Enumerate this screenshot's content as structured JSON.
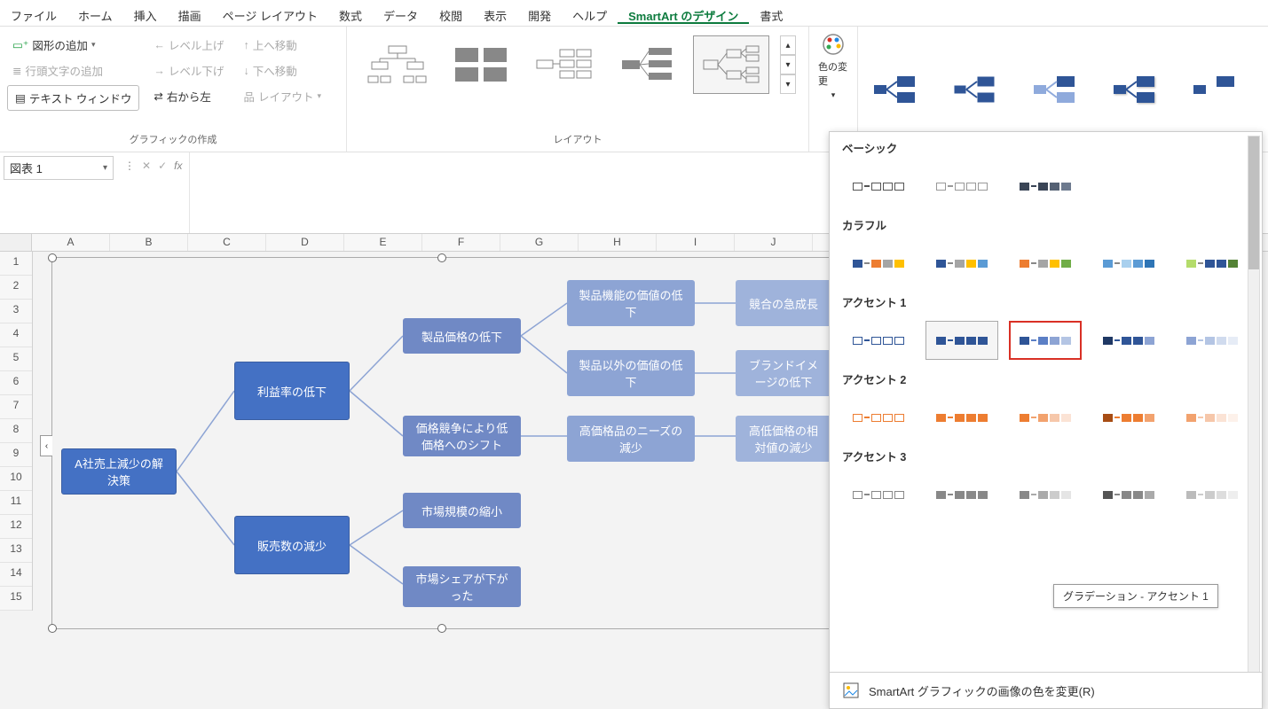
{
  "menu": {
    "items": [
      "ファイル",
      "ホーム",
      "挿入",
      "描画",
      "ページ レイアウト",
      "数式",
      "データ",
      "校閲",
      "表示",
      "開発",
      "ヘルプ",
      "SmartArt のデザイン",
      "書式"
    ],
    "active_index": 11
  },
  "ribbon": {
    "graphics_group": {
      "label": "グラフィックの作成",
      "add_shape": "図形の追加",
      "add_bullet": "行頭文字の追加",
      "text_pane": "テキスト ウィンドウ",
      "promote": "レベル上げ",
      "demote": "レベル下げ",
      "rtl": "右から左",
      "move_up": "上へ移動",
      "move_down": "下へ移動",
      "layout_btn": "レイアウト"
    },
    "layout_group": {
      "label": "レイアウト"
    },
    "color_change": {
      "label": "色の変更"
    }
  },
  "name_box": "図表 1",
  "columns": [
    "A",
    "B",
    "C",
    "D",
    "E",
    "F",
    "G",
    "H",
    "I",
    "J"
  ],
  "rows": [
    1,
    2,
    3,
    4,
    5,
    6,
    7,
    8,
    9,
    10,
    11,
    12,
    13,
    14,
    15
  ],
  "smartart": {
    "root": "A社売上減少の解決策",
    "n1": "利益率の低下",
    "n2": "販売数の減少",
    "n1a": "製品価格の低下",
    "n1b": "価格競争により低価格へのシフト",
    "n2a": "市場規模の縮小",
    "n2b": "市場シェアが下がった",
    "n1a1": "製品機能の価値の低下",
    "n1a2": "製品以外の価値の低下",
    "n1b1": "高価格品のニーズの減少",
    "n1a1r": "競合の急成長",
    "n1a2r": "ブランドイメージの低下",
    "n1b1r": "高低価格の相対値の減少"
  },
  "dropdown": {
    "sections": {
      "basic": "ベーシック",
      "colorful": "カラフル",
      "accent1": "アクセント 1",
      "accent2": "アクセント 2",
      "accent3": "アクセント 3"
    },
    "tooltip": "グラデーション - アクセント 1",
    "footer": "SmartArt グラフィックの画像の色を変更(R)"
  }
}
